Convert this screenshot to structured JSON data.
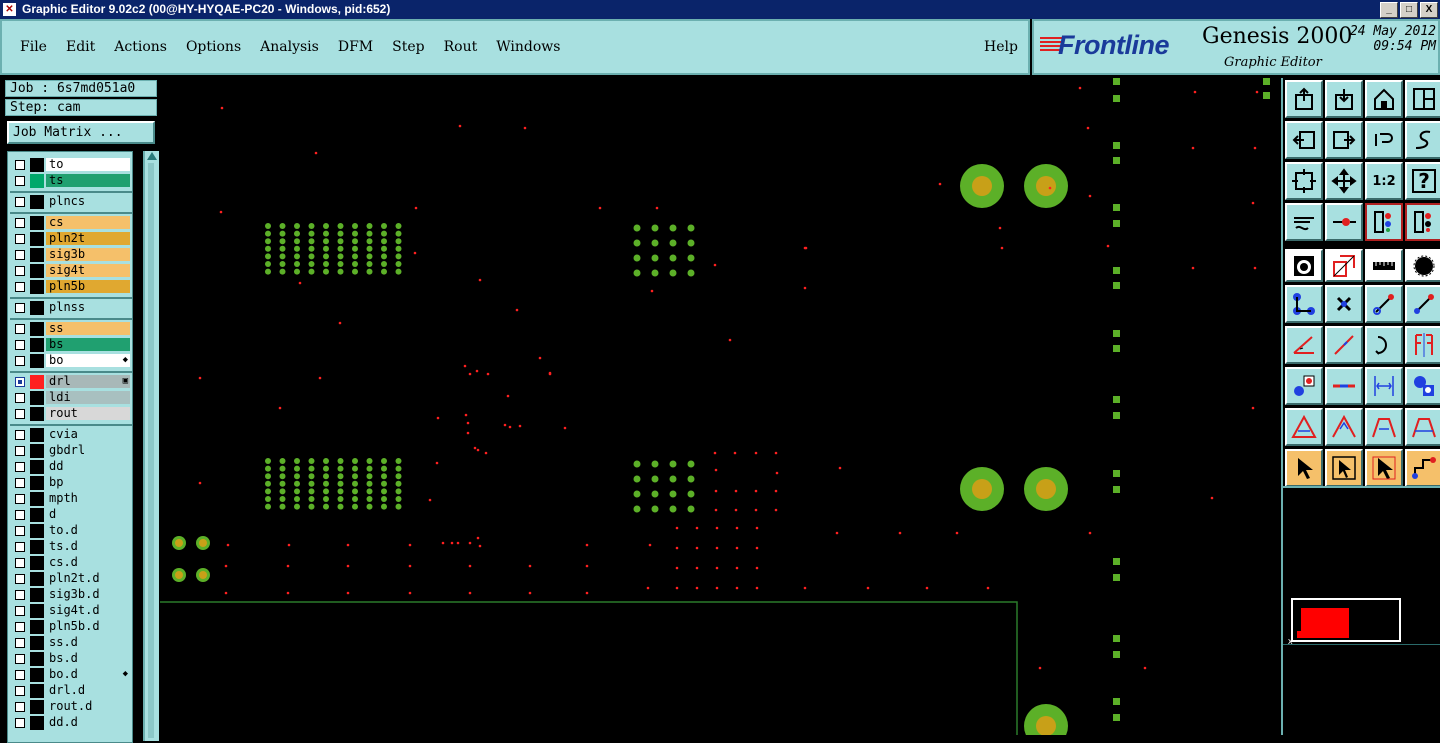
{
  "window": {
    "title": "Graphic Editor 9.02c2 (00@HY-HYQAE-PC20 - Windows, pid:652)",
    "btn_min": "_",
    "btn_max": "□",
    "btn_close": "X"
  },
  "menu": {
    "items": [
      "File",
      "Edit",
      "Actions",
      "Options",
      "Analysis",
      "DFM",
      "Step",
      "Rout",
      "Windows"
    ],
    "help": "Help"
  },
  "brand": {
    "logo": "Frontline",
    "product": "Genesis 2000",
    "subtitle": "Graphic Editor",
    "date": "24 May 2012",
    "time": "09:54 PM"
  },
  "job": {
    "job_line": "Job : 6s7md051a0",
    "step_line": "Step: cam",
    "matrix_button": "Job Matrix ..."
  },
  "layers": [
    {
      "name": "to",
      "swatch": "#000000",
      "bg": "#ffffff",
      "group": 1
    },
    {
      "name": "ts",
      "swatch": "#00a86b",
      "bg": "#20a070",
      "group": 1
    },
    {
      "name": "plncs",
      "swatch": "#000000",
      "bg": "#a8e0e0",
      "group": 2
    },
    {
      "name": "cs",
      "swatch": "#000000",
      "bg": "#f5c06a",
      "group": 3
    },
    {
      "name": "pln2t",
      "swatch": "#000000",
      "bg": "#e0a830",
      "group": 3
    },
    {
      "name": "sig3b",
      "swatch": "#000000",
      "bg": "#f5c06a",
      "group": 3
    },
    {
      "name": "sig4t",
      "swatch": "#000000",
      "bg": "#f5c06a",
      "group": 3
    },
    {
      "name": "pln5b",
      "swatch": "#000000",
      "bg": "#e0a830",
      "group": 3
    },
    {
      "name": "plnss",
      "swatch": "#000000",
      "bg": "#a8e0e0",
      "group": 4
    },
    {
      "name": "ss",
      "swatch": "#000000",
      "bg": "#f5c06a",
      "group": 5
    },
    {
      "name": "bs",
      "swatch": "#000000",
      "bg": "#20a070",
      "group": 5
    },
    {
      "name": "bo",
      "swatch": "#000000",
      "bg": "#ffffff",
      "group": 5,
      "mark": "◆"
    },
    {
      "name": "drl",
      "swatch": "#ff2020",
      "bg": "#a8b8b8",
      "group": 6,
      "selected": true,
      "mark": "▣"
    },
    {
      "name": "ldi",
      "swatch": "#000000",
      "bg": "#a8c0c0",
      "group": 6
    },
    {
      "name": "rout",
      "swatch": "#000000",
      "bg": "#d8d8d8",
      "group": 6
    },
    {
      "name": "cvia",
      "swatch": "#000000",
      "bg": "#a8e0e0",
      "group": 7
    },
    {
      "name": "gbdrl",
      "swatch": "#000000",
      "bg": "#a8e0e0",
      "group": 7
    },
    {
      "name": "dd",
      "swatch": "#000000",
      "bg": "#a8e0e0",
      "group": 7
    },
    {
      "name": "bp",
      "swatch": "#000000",
      "bg": "#a8e0e0",
      "group": 7
    },
    {
      "name": "mpth",
      "swatch": "#000000",
      "bg": "#a8e0e0",
      "group": 7
    },
    {
      "name": "d",
      "swatch": "#000000",
      "bg": "#a8e0e0",
      "group": 7
    },
    {
      "name": "to.d",
      "swatch": "#000000",
      "bg": "#a8e0e0",
      "group": 7
    },
    {
      "name": "ts.d",
      "swatch": "#000000",
      "bg": "#a8e0e0",
      "group": 7
    },
    {
      "name": "cs.d",
      "swatch": "#000000",
      "bg": "#a8e0e0",
      "group": 7
    },
    {
      "name": "pln2t.d",
      "swatch": "#000000",
      "bg": "#a8e0e0",
      "group": 7
    },
    {
      "name": "sig3b.d",
      "swatch": "#000000",
      "bg": "#a8e0e0",
      "group": 7
    },
    {
      "name": "sig4t.d",
      "swatch": "#000000",
      "bg": "#a8e0e0",
      "group": 7
    },
    {
      "name": "pln5b.d",
      "swatch": "#000000",
      "bg": "#a8e0e0",
      "group": 7
    },
    {
      "name": "ss.d",
      "swatch": "#000000",
      "bg": "#a8e0e0",
      "group": 7
    },
    {
      "name": "bs.d",
      "swatch": "#000000",
      "bg": "#a8e0e0",
      "group": 7
    },
    {
      "name": "bo.d",
      "swatch": "#000000",
      "bg": "#a8e0e0",
      "group": 7,
      "mark": "◆"
    },
    {
      "name": "drl.d",
      "swatch": "#000000",
      "bg": "#a8e0e0",
      "group": 7
    },
    {
      "name": "rout.d",
      "swatch": "#000000",
      "bg": "#a8e0e0",
      "group": 7
    },
    {
      "name": "dd.d",
      "swatch": "#000000",
      "bg": "#a8e0e0",
      "group": 7
    }
  ],
  "tools": [
    {
      "icon": "export-icon",
      "style": "c"
    },
    {
      "icon": "import-icon",
      "style": "c"
    },
    {
      "icon": "home-icon",
      "style": "c"
    },
    {
      "icon": "window-icon",
      "style": "c"
    },
    {
      "icon": "arrow-left-icon",
      "style": "c"
    },
    {
      "icon": "arrow-right-icon",
      "style": "c"
    },
    {
      "icon": "undo-icon",
      "style": "c"
    },
    {
      "icon": "redo-icon",
      "style": "c"
    },
    {
      "icon": "zoom-fit-icon",
      "style": "c"
    },
    {
      "icon": "pan-icon",
      "style": "c"
    },
    {
      "icon": "scale-icon",
      "style": "c",
      "text": "1:2"
    },
    {
      "icon": "help-icon",
      "style": "c",
      "text": "?"
    },
    {
      "icon": "measure-tool-icon",
      "style": "c"
    },
    {
      "icon": "probe-icon",
      "style": "c"
    },
    {
      "icon": "layers-red-icon",
      "style": "c",
      "red": true
    },
    {
      "icon": "layers-red-alt-icon",
      "style": "c",
      "red": true
    },
    {
      "icon": "pad-icon",
      "style": "w",
      "gap": true
    },
    {
      "icon": "select-area-icon",
      "style": "w",
      "gap": true
    },
    {
      "icon": "ruler-icon",
      "style": "w",
      "gap": true
    },
    {
      "icon": "circle-icon",
      "style": "w",
      "gap": true
    },
    {
      "icon": "connect-icon",
      "style": "c"
    },
    {
      "icon": "cross-icon",
      "style": "c"
    },
    {
      "icon": "line-dots-icon",
      "style": "c"
    },
    {
      "icon": "line-dots-alt-icon",
      "style": "c"
    },
    {
      "icon": "angle-icon",
      "style": "c"
    },
    {
      "icon": "diagonal-icon",
      "style": "c"
    },
    {
      "icon": "arc-icon",
      "style": "c"
    },
    {
      "icon": "mirror-icon",
      "style": "c"
    },
    {
      "icon": "snap-icon",
      "style": "c"
    },
    {
      "icon": "horizontal-line-icon",
      "style": "c"
    },
    {
      "icon": "dimension-icon",
      "style": "c"
    },
    {
      "icon": "group-icon",
      "style": "c"
    },
    {
      "icon": "triangle-icon",
      "style": "c"
    },
    {
      "icon": "peak-icon",
      "style": "c"
    },
    {
      "icon": "trapezoid-icon",
      "style": "c"
    },
    {
      "icon": "trapezoid-alt-icon",
      "style": "c"
    },
    {
      "icon": "pointer-icon",
      "style": "y"
    },
    {
      "icon": "pointer-box-icon",
      "style": "y"
    },
    {
      "icon": "pointer-alt-icon",
      "style": "y"
    },
    {
      "icon": "route-icon",
      "style": "y"
    }
  ],
  "overview": {
    "close_mark": "x"
  },
  "colors": {
    "panel": "#a8e0e0",
    "pad_green": "#5cb028",
    "pad_gold": "#c8a018",
    "drill": "#ff2020",
    "outline": "#2a7a2a"
  }
}
